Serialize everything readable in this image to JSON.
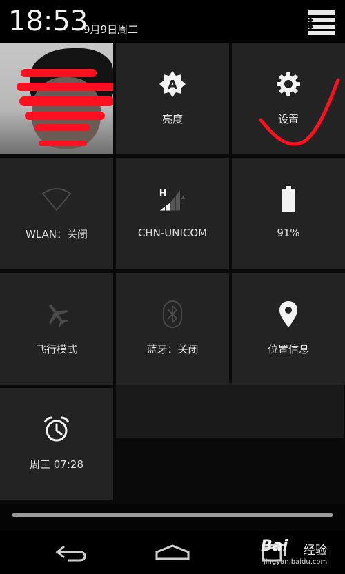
{
  "status_bar": {
    "time": "18:53",
    "date": "9月9日周二",
    "settings_icon": "list-settings-icon"
  },
  "tiles": [
    {
      "name": "user",
      "label": "",
      "icon": "user-photo"
    },
    {
      "name": "brightness",
      "label": "亮度",
      "icon": "brightness-auto-icon"
    },
    {
      "name": "settings",
      "label": "设置",
      "icon": "gear-icon"
    },
    {
      "name": "wlan",
      "label": "WLAN：关闭",
      "icon": "wifi-icon"
    },
    {
      "name": "carrier",
      "label": "CHN-UNICOM",
      "icon": "signal-icon",
      "network_type": "H"
    },
    {
      "name": "battery",
      "label": "91%",
      "icon": "battery-icon",
      "level": 0.91
    },
    {
      "name": "airplane",
      "label": "飞行模式",
      "icon": "airplane-icon"
    },
    {
      "name": "bluetooth",
      "label": "蓝牙：关闭",
      "icon": "bluetooth-icon"
    },
    {
      "name": "location",
      "label": "位置信息",
      "icon": "location-pin-icon"
    },
    {
      "name": "alarm",
      "label": "周三 07:28",
      "icon": "alarm-clock-icon"
    }
  ],
  "nav": {
    "back": "back-icon",
    "home": "home-icon",
    "recents": "recents-icon"
  },
  "watermark": {
    "logo": "Bai",
    "brand": "经验",
    "url": "jingyan.baidu.com"
  },
  "colors": {
    "tile_bg": "#232323",
    "annotation_red": "#ff1020"
  }
}
